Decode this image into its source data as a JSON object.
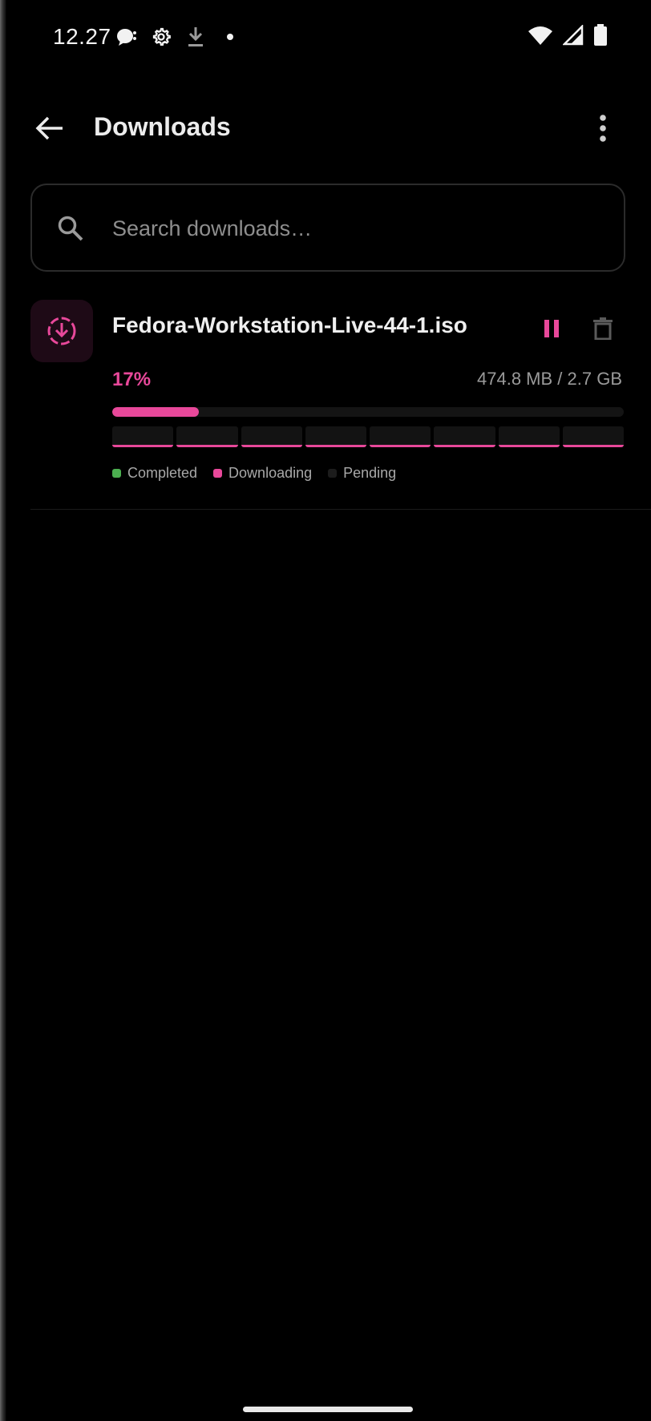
{
  "status_bar": {
    "time": "12.27",
    "icons": [
      "chat-bubble-icon",
      "gear-icon",
      "download-icon",
      "dot-icon",
      "wifi-icon",
      "cellular-signal-icon",
      "battery-icon"
    ]
  },
  "app_bar": {
    "title": "Downloads",
    "back_icon": "arrow-left-icon",
    "more_icon": "more-vertical-icon"
  },
  "search": {
    "placeholder": "Search downloads…",
    "value": ""
  },
  "downloads": [
    {
      "file_name": "Fedora-Workstation-Live-44-1.iso",
      "percent_label": "17%",
      "progress_fraction": 0.17,
      "size_label": "474.8 MB / 2.7 GB",
      "status": "downloading",
      "segment_count": 8,
      "actions": [
        "pause-icon",
        "trash-icon"
      ]
    }
  ],
  "legend": {
    "completed": "Completed",
    "downloading": "Downloading",
    "pending": "Pending"
  },
  "colors": {
    "accent": "#e8489a",
    "completed": "#4caf50",
    "pending": "#1c1c1c",
    "background": "#000000",
    "thumb_bg": "#1e0a16"
  }
}
